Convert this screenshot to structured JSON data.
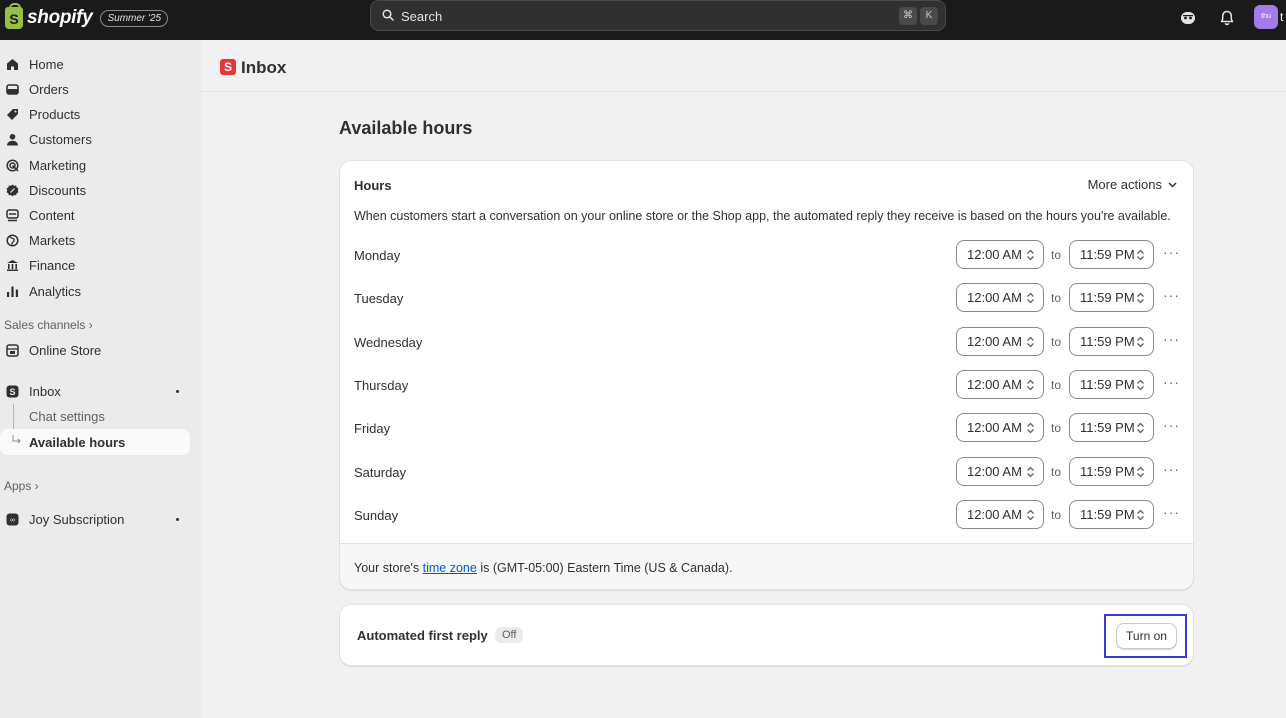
{
  "topbar": {
    "logo_text": "shopify",
    "logo_glyph": "S",
    "edition": "Summer '25",
    "search_placeholder": "Search",
    "shortcut_keys": [
      "⌘",
      "K"
    ],
    "avatar_initials": "thu",
    "avatar_trailing": "t"
  },
  "sidebar": {
    "items": [
      {
        "label": "Home",
        "icon": "home-icon"
      },
      {
        "label": "Orders",
        "icon": "orders-icon"
      },
      {
        "label": "Products",
        "icon": "tag-icon"
      },
      {
        "label": "Customers",
        "icon": "person-icon"
      },
      {
        "label": "Marketing",
        "icon": "target-icon"
      },
      {
        "label": "Discounts",
        "icon": "discount-icon"
      },
      {
        "label": "Content",
        "icon": "content-icon"
      },
      {
        "label": "Markets",
        "icon": "globe-icon"
      },
      {
        "label": "Finance",
        "icon": "bank-icon"
      },
      {
        "label": "Analytics",
        "icon": "bar-chart-icon"
      }
    ],
    "sales_channels_label": "Sales channels ›",
    "online_store": "Online Store",
    "inbox": "Inbox",
    "chat_settings": "Chat settings",
    "available_hours": "Available hours",
    "apps_label": "Apps ›",
    "joy_subscription": "Joy Subscription"
  },
  "header": {
    "badge_glyph": "S",
    "title": "Inbox"
  },
  "main": {
    "page_title": "Available hours",
    "hours_card": {
      "title": "Hours",
      "more_actions": "More actions",
      "description": "When customers start a conversation on your online store or the Shop app, the automated reply they receive is based on the hours you're available.",
      "to_label": "to",
      "more_glyph": "···",
      "days": [
        {
          "name": "Monday",
          "start": "12:00 AM",
          "end": "11:59 PM"
        },
        {
          "name": "Tuesday",
          "start": "12:00 AM",
          "end": "11:59 PM"
        },
        {
          "name": "Wednesday",
          "start": "12:00 AM",
          "end": "11:59 PM"
        },
        {
          "name": "Thursday",
          "start": "12:00 AM",
          "end": "11:59 PM"
        },
        {
          "name": "Friday",
          "start": "12:00 AM",
          "end": "11:59 PM"
        },
        {
          "name": "Saturday",
          "start": "12:00 AM",
          "end": "11:59 PM"
        },
        {
          "name": "Sunday",
          "start": "12:00 AM",
          "end": "11:59 PM"
        }
      ],
      "tz_prefix": "Your store's ",
      "tz_link": "time zone",
      "tz_suffix": " is (GMT-05:00) Eastern Time (US & Canada)."
    },
    "reply_card": {
      "title": "Automated first reply",
      "status": "Off",
      "button": "Turn on"
    }
  }
}
